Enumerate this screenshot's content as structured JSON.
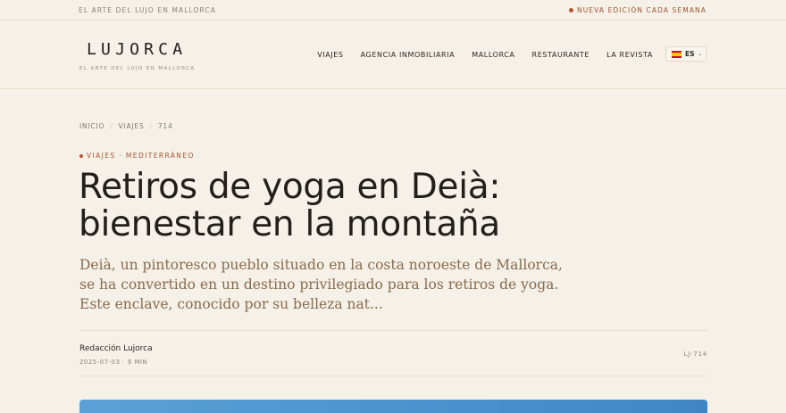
{
  "topbar": {
    "left_text": "EL ARTE DEL LUJO EN MALLORCA",
    "right_text": "NUEVA EDICIÓN CADA SEMANA"
  },
  "header": {
    "logo": "LUJORCA",
    "tagline": "EL ARTE DEL LUJO EN MALLORCA",
    "nav": [
      "VIAJES",
      "AGENCIA INMOBILIARIA",
      "MALLORCA",
      "RESTAURANTE",
      "LA REVISTA"
    ],
    "lang": {
      "code": "ES",
      "flag_icon": "spain-flag-icon"
    }
  },
  "breadcrumb": [
    "INICIO",
    "VIAJES",
    "714"
  ],
  "article": {
    "kicker": "VIAJES · MEDITERRÁNEO",
    "title": "Retiros de yoga en Deià: bienestar en la montaña",
    "lede": "Deià, un pintoresco pueblo situado en la costa noroeste de Mallorca, se ha convertido en un destino privilegiado para los retiros de yoga. Este enclave, conocido por su belleza nat...",
    "author": "Redacción Lujorca",
    "meta": "2025-07-03 · 9 MIN",
    "code": "LJ-714"
  },
  "colors": {
    "background": "#f5f1e8",
    "accent": "#a8542e",
    "hero": "#4b94d0"
  }
}
